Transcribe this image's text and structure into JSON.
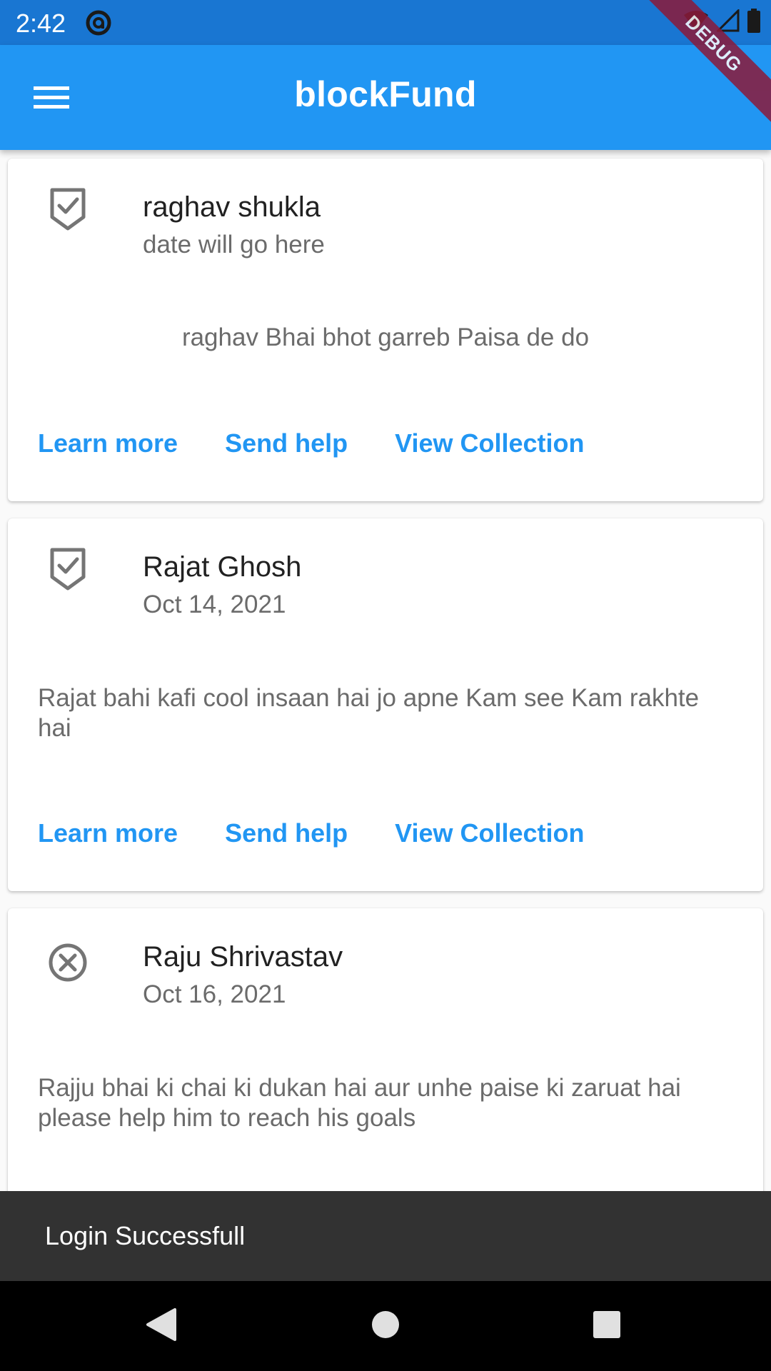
{
  "status_bar": {
    "time": "2:42"
  },
  "app_bar": {
    "title": "blockFund",
    "debug_label": "DEBUG"
  },
  "cards": [
    {
      "status_icon": "verified-shield-icon",
      "name": "raghav shukla",
      "date": "date will go here",
      "description": "raghav Bhai bhot garreb Paisa de do",
      "actions": [
        "Learn more",
        "Send help",
        "View Collection"
      ]
    },
    {
      "status_icon": "verified-shield-icon",
      "name": "Rajat Ghosh",
      "date": "Oct 14, 2021",
      "description": "Rajat bahi kafi cool insaan hai jo apne Kam see Kam rakhte hai",
      "actions": [
        "Learn more",
        "Send help",
        "View Collection"
      ]
    },
    {
      "status_icon": "cancel-circle-icon",
      "name": "Raju Shrivastav",
      "date": "Oct 16, 2021",
      "description": "Rajju bhai ki chai ki dukan hai aur unhe paise ki zaruat hai please help him to reach his goals",
      "actions": []
    }
  ],
  "snackbar": {
    "message": "Login Successfull"
  },
  "colors": {
    "primary": "#2196f3",
    "status_bar": "#1976d2",
    "snackbar": "#323232"
  }
}
